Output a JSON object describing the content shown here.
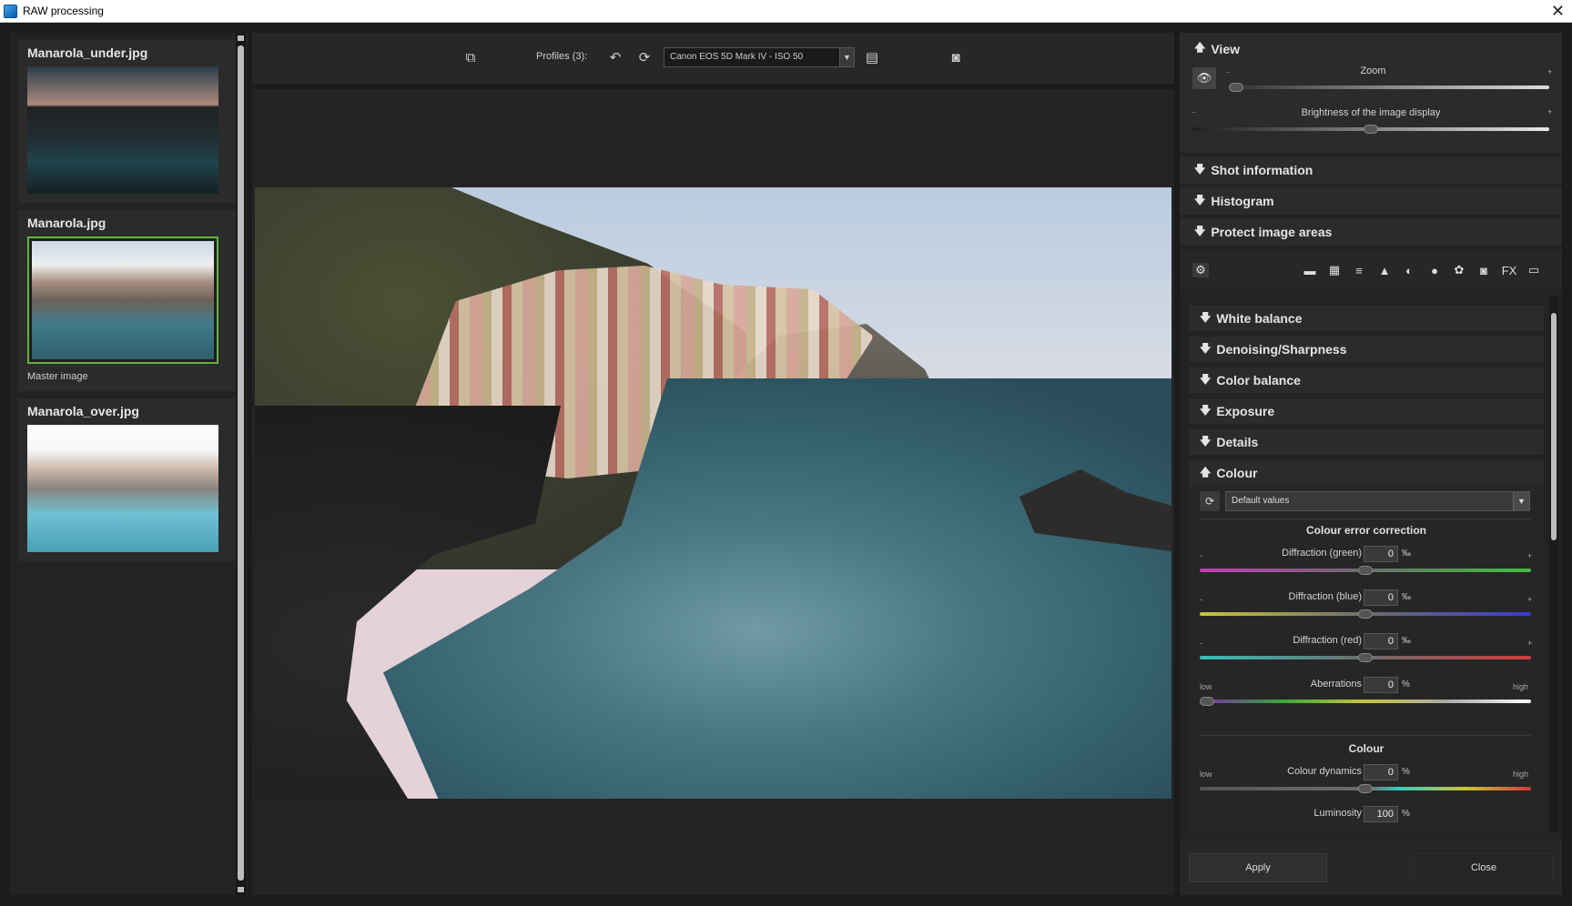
{
  "window": {
    "title": "RAW processing",
    "close_glyph": "✕"
  },
  "thumbnails": [
    {
      "filename": "Manarola_under.jpg",
      "caption": ""
    },
    {
      "filename": "Manarola.jpg",
      "caption": "Master image"
    },
    {
      "filename": "Manarola_over.jpg",
      "caption": ""
    }
  ],
  "toolbar": {
    "profiles_label": "Profiles (3):",
    "profile_value": "Canon EOS 5D Mark IV - ISO 50"
  },
  "view": {
    "title": "View",
    "zoom_label": "Zoom",
    "zoom_level": 0.0,
    "brightness_label": "Brightness of the image display",
    "brightness_level": 0.5,
    "minus": "-",
    "plus": "+"
  },
  "sections": {
    "shot_information": "Shot information",
    "histogram": "Histogram",
    "protect_image_areas": "Protect image areas"
  },
  "subsections": {
    "white_balance": "White balance",
    "denoising": "Denoising/Sharpness",
    "color_balance": "Color balance",
    "exposure": "Exposure",
    "details": "Details",
    "colour": "Colour"
  },
  "colour": {
    "preset_value": "Default values",
    "error_correction_title": "Colour error correction",
    "diffraction_green": {
      "label": "Diffraction (green)",
      "value": "0",
      "unit": "‰",
      "level": 0.5
    },
    "diffraction_blue": {
      "label": "Diffraction (blue)",
      "value": "0",
      "unit": "‰",
      "level": 0.5
    },
    "diffraction_red": {
      "label": "Diffraction (red)",
      "value": "0",
      "unit": "‰",
      "level": 0.5
    },
    "aberrations": {
      "label": "Aberrations",
      "value": "0",
      "unit": "%",
      "level": 0.0,
      "low": "low",
      "high": "high"
    },
    "colour_title": "Colour",
    "colour_dynamics": {
      "label": "Colour dynamics",
      "value": "0",
      "unit": "%",
      "level": 0.5,
      "low": "low",
      "high": "high"
    },
    "luminosity": {
      "label": "Luminosity",
      "value": "100",
      "unit": "%"
    }
  },
  "buttons": {
    "apply": "Apply",
    "close": "Close"
  },
  "colors": {
    "accent_green": "#5fb53f",
    "panel_bg": "#232323"
  }
}
